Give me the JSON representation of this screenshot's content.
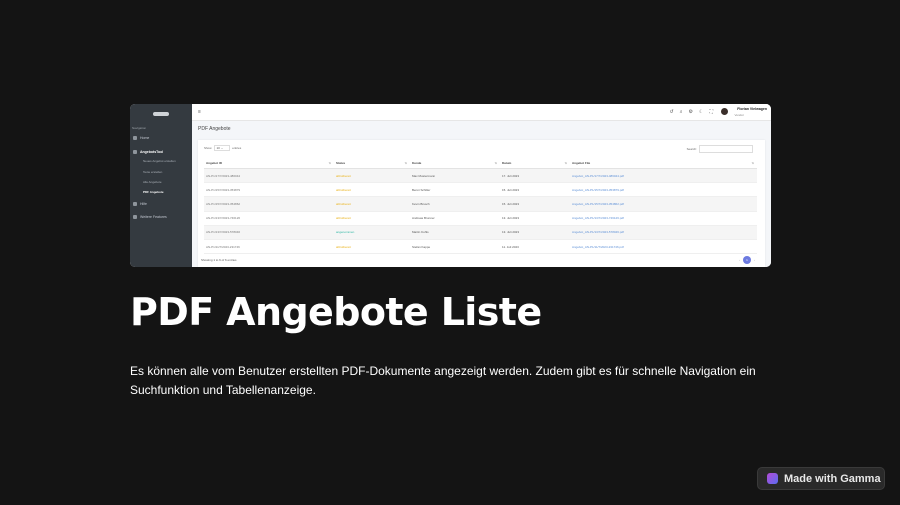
{
  "screenshot": {
    "sidebar": {
      "heading": "Navigation",
      "items": [
        {
          "label": "Home",
          "icon": "home-icon"
        },
        {
          "label": "AngebotsTool",
          "icon": "document-icon",
          "sub": [
            {
              "label": "Neues Angebot erstellen"
            },
            {
              "label": "Texte erstellen"
            },
            {
              "label": "Alle Angebote"
            },
            {
              "label": "PDF Angebote",
              "active": true
            }
          ]
        },
        {
          "label": "Hilfe",
          "icon": "help-icon"
        },
        {
          "label": "Weitere Features",
          "icon": "grid-icon"
        }
      ]
    },
    "topbar": {
      "user_name": "Florian Vielwagen",
      "user_role": "Vendor"
    },
    "page_title": "PDF Angebote",
    "table": {
      "show_label": "Show",
      "length_value": "10",
      "entries_label": "entries",
      "search_label": "Search:",
      "columns": [
        "Angebot ID",
        "Status",
        "Kunde",
        "Datum",
        "Angebot File"
      ],
      "rows": [
        {
          "id": "AN-P1/17/7/2023-486044",
          "status": "abholbereit",
          "kunde": "Max Mustermann",
          "datum": "17. Juli 2023",
          "file": "Angebot_AN-P1/17/7/2023-486044.pdf"
        },
        {
          "id": "AN-P1/15/7/2023-353879",
          "status": "abholbereit",
          "kunde": "Benni Schiller",
          "datum": "15. Juli 2023",
          "file": "Angebot_AN-P1/15/7/2023-353879.pdf"
        },
        {
          "id": "AN-P1/15/7/2023-354862",
          "status": "abholbereit",
          "kunde": "Kevin Brusch",
          "datum": "15. Juli 2023",
          "file": "Angebot_AN-P1/15/7/2023-354862.pdf"
        },
        {
          "id": "AN-P1/13/7/2023-746126",
          "status": "abholbereit",
          "kunde": "Andreas Brunner",
          "datum": "13. Juli 2023",
          "file": "Angebot_AN-P1/13/7/2023-746126.pdf"
        },
        {
          "id": "AN-P1/13/7/2023-578046",
          "status": "angenommen",
          "kunde": "Martin Kuhls",
          "datum": "13. Juli 2023",
          "file": "Angebot_AN-P1/13/7/2023-578046.pdf"
        },
        {
          "id": "AN-P1/11/7/2023-231746",
          "status": "abholbereit",
          "kunde": "Stefan Kappe",
          "datum": "11. Juli 2023",
          "file": "Angebot_AN-P1/11/7/2023-231746.pdf"
        }
      ],
      "showing_text": "Showing 1 to 6 of 6 entries",
      "current_page": "1"
    }
  },
  "slide": {
    "title": "PDF Angebote Liste",
    "description": "Es können alle vom Benutzer erstellten PDF-Dokumente angezeigt werden. Zudem gibt es für schnelle Navigation ein Suchfunktion und Tabellenanzeige."
  },
  "badge": {
    "label": "Made with Gamma",
    "icon": "gamma-logo-icon"
  },
  "colors": {
    "background": "#141414",
    "sidebar": "#343a40",
    "status_pending": "#e9b21a",
    "status_accepted": "#2bb6a3",
    "link": "#5c8fd6",
    "pager_active": "#6c7ae0"
  }
}
